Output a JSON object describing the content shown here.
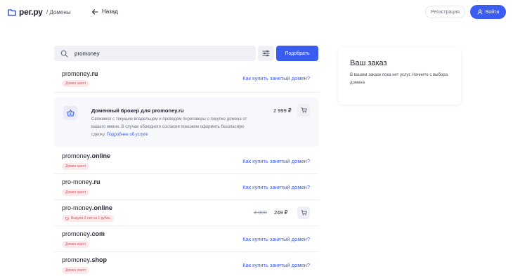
{
  "header": {
    "logo_text": "рег.ру",
    "breadcrumb": "/ Домены",
    "back_label": "Назад",
    "register_label": "Регистрация",
    "login_label": "Войти"
  },
  "search": {
    "query": "promoney",
    "submit_label": "Подобрать"
  },
  "results": [
    {
      "base": "promoney",
      "tld": ".ru",
      "badge": "Домен занят",
      "action": "Как купить занятый домен?"
    },
    {
      "base": "promoney",
      "tld": ".online",
      "badge": "Домен занят",
      "action": "Как купить занятый домен?"
    },
    {
      "base": "pro-money",
      "tld": ".ru",
      "badge": "Домен занят",
      "action": "Как купить занятый домен?"
    },
    {
      "base": "pro-money",
      "tld": ".online",
      "badge": "Выкупа 2 лет за 1 рубль",
      "old_price": "4 000",
      "price": "249 ₽"
    },
    {
      "base": "promoney",
      "tld": ".com",
      "badge": "Домен занят",
      "action": "Как купить занятый домен?"
    },
    {
      "base": "promoney",
      "tld": ".shop",
      "badge": "Домен занят",
      "action": "Как купить занятый домен?"
    }
  ],
  "broker": {
    "title": "Доменный брокер для promoney.ru",
    "text": "Свяжемся с текущим владельцем и проведем переговоры о покупке домена от вашего имени. В случае обоюдного согласия поможем оформить безопасную сделку.",
    "link": "Подробнее об услуге",
    "price": "2 999 ₽"
  },
  "order": {
    "title": "Ваш заказ",
    "text": "В вашем заказе пока нет услуг. Начните с выбора домена"
  },
  "colors": {
    "accent": "#3a5cf0",
    "badge_bg": "#fde8ea",
    "badge_text": "#e05260"
  }
}
